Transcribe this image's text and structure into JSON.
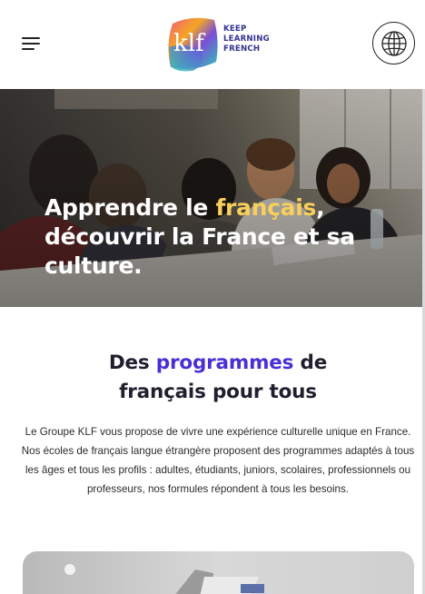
{
  "header": {
    "menu_icon": "hamburger-menu-icon",
    "logo": {
      "mark_text": "klf",
      "line1": "KEEP",
      "line2": "LEARNING",
      "line3": "FRENCH"
    },
    "language_icon": "globe-icon"
  },
  "hero": {
    "title_part1": "Apprendre le ",
    "title_highlight": "français",
    "title_part2": ",",
    "title_line2": "découvrir la France et sa",
    "title_line3": "culture.",
    "highlight_color": "#f8cf5a"
  },
  "programs": {
    "title_part1": "Des ",
    "title_accent": "programmes",
    "title_part2": " de",
    "title_line2": "français pour tous",
    "accent_color": "#4a2fd6",
    "description": "Le Groupe KLF vous propose de vivre une expérience culturelle unique en France. Nos écoles de français langue étrangère proposent des programmes adaptés à tous les âges et tous les profils : adultes, étudiants, juniors, scolaires, professionnels ou professeurs, nos formules répondent à tous les besoins."
  }
}
